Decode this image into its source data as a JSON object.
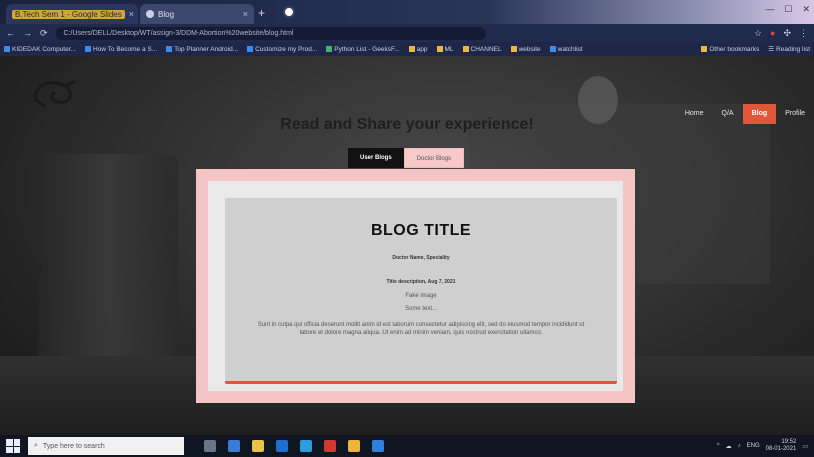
{
  "browser": {
    "tabs": [
      {
        "label": "B.Tech Sem 1 - Google Slides",
        "active": false
      },
      {
        "label": "Blog",
        "active": true
      }
    ],
    "address": "C:/Users/DELL/Desktop/WT/assign-3/DDM-Abortion%20website/blog.html",
    "bookmarks": [
      "KIDEDAK Computer...",
      "How To Become a S...",
      "Top Planner Android...",
      "Customize my Prod...",
      "Python List - GeeksF...",
      "app",
      "ML",
      "CHANNEL",
      "website",
      "watchlist",
      "Other bookmarks",
      "Reading list"
    ]
  },
  "site": {
    "nav": [
      "Home",
      "Q/A",
      "Blog",
      "Profile"
    ],
    "active_nav": "Blog",
    "headline": "Read and Share your experience!",
    "tabs": {
      "user": "User Blogs",
      "doctor": "Doctor Blogs"
    },
    "blog": {
      "title": "BLOG TITLE",
      "doctor": "Doctor Name, Speciality",
      "meta": "Title description, Aug 7, 2021",
      "image_label": "Fake image",
      "short_text": "Some text...",
      "paragraph": "Sunt in culpa qui officia deserunt mollit anim id est laborum consectetur adipiscing elit, sed do eiusmod tempor incididunt ut labore et dolore magna aliqua. Ut enim ad minim veniam, quis nostrud exercitation ullamco."
    }
  },
  "taskbar": {
    "search_placeholder": "Type here to search",
    "time": "19:52",
    "date": "08-01-2021",
    "lang": "ENG"
  },
  "colors": {
    "accent": "#e0563a",
    "panel_pink": "#f5c4c4",
    "card_gray": "#cfcfcf"
  }
}
